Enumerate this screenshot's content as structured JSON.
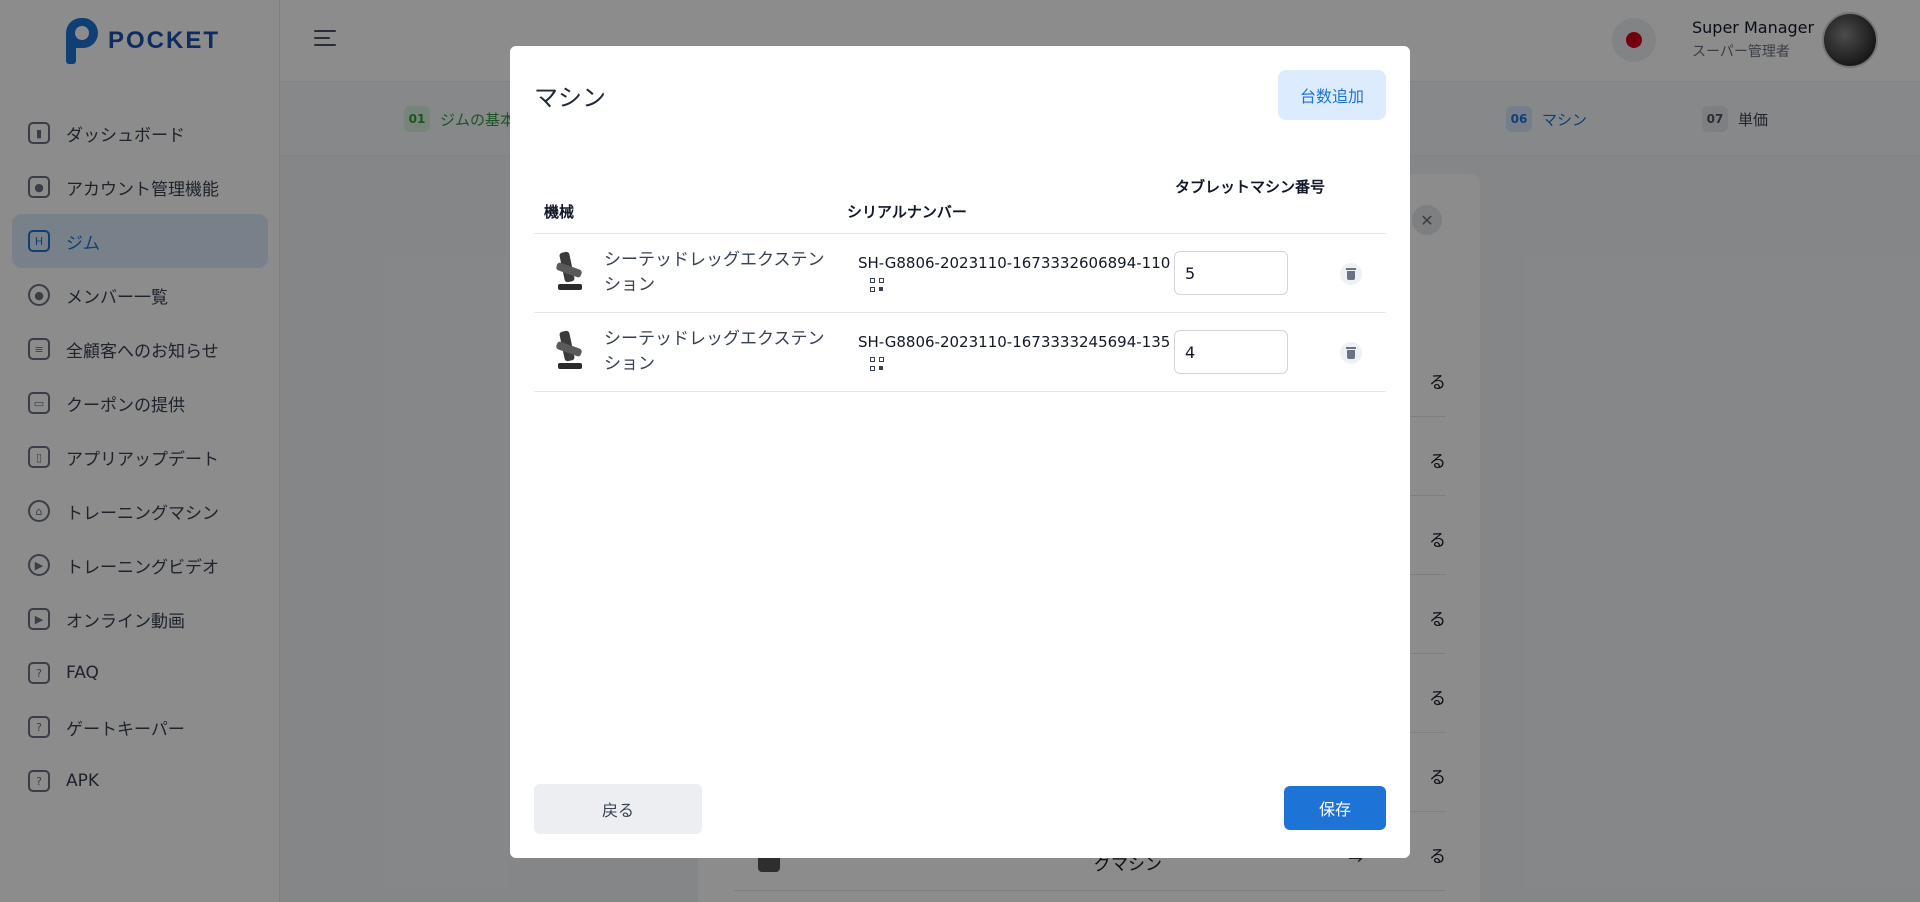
{
  "app": {
    "logo_text": "POCKET"
  },
  "sidebar": {
    "items": [
      {
        "label": "ダッシュボード",
        "icon": "chart-icon"
      },
      {
        "label": "アカウント管理機能",
        "icon": "account-icon"
      },
      {
        "label": "ジム",
        "icon": "gym-icon",
        "active": true
      },
      {
        "label": "メンバー一覧",
        "icon": "members-icon"
      },
      {
        "label": "全顧客へのお知らせ",
        "icon": "announcement-icon"
      },
      {
        "label": "クーポンの提供",
        "icon": "coupon-icon"
      },
      {
        "label": "アプリアップデート",
        "icon": "phone-icon"
      },
      {
        "label": "トレーニングマシン",
        "icon": "machine-icon"
      },
      {
        "label": "トレーニングビデオ",
        "icon": "video-icon"
      },
      {
        "label": "オンライン動画",
        "icon": "online-video-icon"
      },
      {
        "label": "FAQ",
        "icon": "faq-icon"
      },
      {
        "label": "ゲートキーパー",
        "icon": "gatekeeper-icon"
      },
      {
        "label": "APK",
        "icon": "apk-icon"
      }
    ]
  },
  "header": {
    "user_name": "Super Manager",
    "user_role": "スーパー管理者"
  },
  "steps": [
    {
      "num": "01",
      "label": "ジムの基本情",
      "state": "done"
    },
    {
      "num": "06",
      "label": "マシン",
      "state": "current"
    },
    {
      "num": "07",
      "label": "単価",
      "state": "todo"
    }
  ],
  "background_card": {
    "row_label": "る",
    "bottom_label": "グマシン",
    "arrow": "→"
  },
  "modal": {
    "title": "マシン",
    "add_label": "台数追加",
    "columns": {
      "machine": "機械",
      "serial": "シリアルナンバー",
      "tablet": "タブレットマシン番号"
    },
    "rows": [
      {
        "name": "シーテッドレッグエクステンション",
        "serial": "SH-G8806-2023110-1673332606894-110",
        "tablet": "5"
      },
      {
        "name": "シーテッドレッグエクステンション",
        "serial": "SH-G8806-2023110-1673333245694-135",
        "tablet": "4"
      }
    ],
    "back_label": "戻る",
    "save_label": "保存"
  },
  "colors": {
    "accent": "#1e73d6",
    "step_done": "#2f9a45",
    "overlay": "rgba(0,0,0,0.45)"
  }
}
